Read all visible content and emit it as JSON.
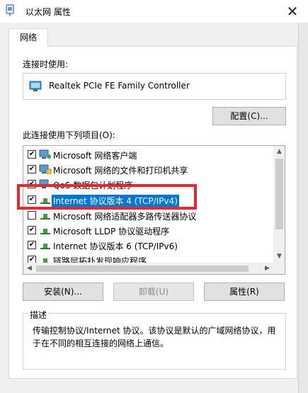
{
  "window": {
    "title": "以太网 属性",
    "close_glyph": "✕"
  },
  "tabs": [
    {
      "label": "网络"
    }
  ],
  "connect_using": {
    "label": "连接时使用:",
    "adapter_name": "Realtek PCIe FE Family Controller",
    "configure_button": "配置(C)..."
  },
  "items_section": {
    "label": "此连接使用下列项目(O):",
    "items": [
      {
        "label": "Microsoft 网络客户端",
        "checked": true,
        "icon": "network-client-icon",
        "selected": false
      },
      {
        "label": "Microsoft 网络的文件和打印机共享",
        "checked": true,
        "icon": "file-sharing-icon",
        "selected": false
      },
      {
        "label": "QoS 数据包计划程序",
        "checked": true,
        "icon": "qos-icon",
        "selected": false
      },
      {
        "label": "Internet 协议版本 4 (TCP/IPv4)",
        "checked": true,
        "icon": "protocol-icon",
        "selected": true
      },
      {
        "label": "Microsoft 网络适配器多路传送器协议",
        "checked": false,
        "icon": "protocol-icon",
        "selected": false
      },
      {
        "label": "Microsoft LLDP 协议驱动程序",
        "checked": true,
        "icon": "protocol-icon",
        "selected": false
      },
      {
        "label": "Internet 协议版本 6 (TCP/IPv6)",
        "checked": true,
        "icon": "protocol-icon",
        "selected": false
      },
      {
        "label": "链路层拓扑发现响应程序",
        "checked": true,
        "icon": "protocol-icon",
        "selected": false
      }
    ]
  },
  "buttons": {
    "install": "安装(N)...",
    "uninstall": "卸载(U)",
    "properties": "属性(R)"
  },
  "description": {
    "title": "描述",
    "text": "传输控制协议/Internet 协议。该协议是默认的广域网络协议，用于在不同的相互连接的网络上通信。"
  },
  "colors": {
    "highlight_frame": "#e8272d",
    "selection": "#0078d7",
    "focus_border": "#0078d7"
  }
}
